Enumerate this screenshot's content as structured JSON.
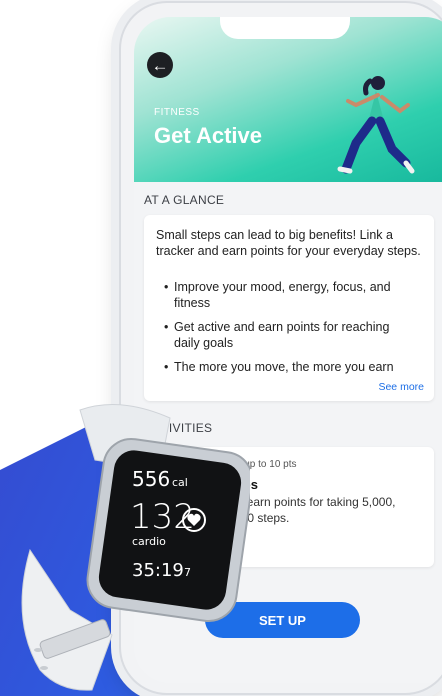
{
  "header": {
    "eyebrow": "FITNESS",
    "title": "Get Active"
  },
  "glance": {
    "section_title": "AT A GLANCE",
    "description": "Small steps can lead to big benefits! Link a tracker and earn points for your everyday steps.",
    "bullets": [
      "Improve your mood, energy, focus, and fitness",
      "Get active and earn points for reaching daily goals",
      "The more you move, the more you earn"
    ],
    "see_more_label": "See more"
  },
  "activities": {
    "section_title": "ACTIVITIES",
    "item_meta": "ity / Earn up to 10 pts",
    "item_title": "steps",
    "item_desc": "can earn points for taking 5,000, 7,000 steps."
  },
  "setup_label": "SET UP",
  "watch": {
    "calories": "556",
    "calories_unit": "cal",
    "heart_rate": "132",
    "mode": "cardio",
    "time": "35:19",
    "time_fraction": "7"
  },
  "colors": {
    "hero_teal": "#16b79c",
    "primary_blue": "#1d6ee8",
    "link_blue": "#1e6fe6",
    "background_blue": "#2e5be0"
  },
  "icons": {
    "back": "back-arrow-icon",
    "heart": "heart-icon"
  }
}
